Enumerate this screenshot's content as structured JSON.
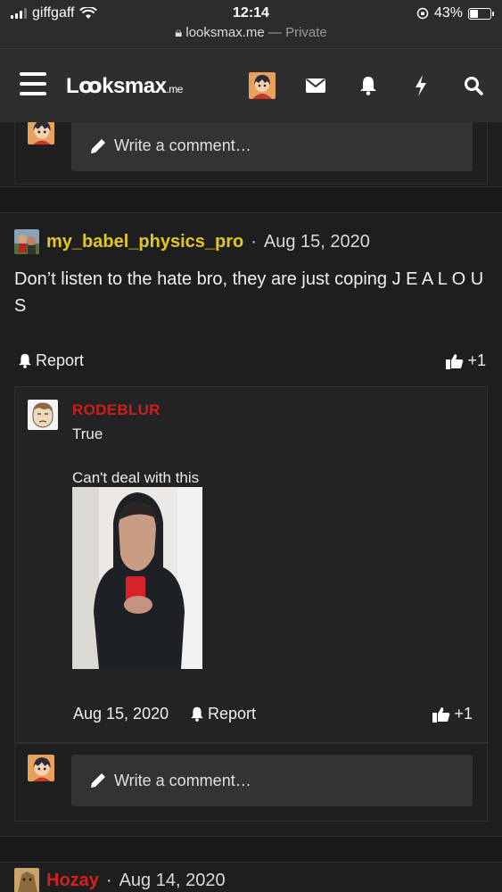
{
  "status_bar": {
    "carrier": "giffgaff",
    "time": "12:14",
    "battery": "43%",
    "battery_level": 0.43
  },
  "url_bar": {
    "domain": "looksmax.me",
    "separator": " — ",
    "mode": "Private"
  },
  "navbar": {
    "logo": "Lꝏksmax",
    "logo_suffix": ".me",
    "icons": [
      "menu-icon",
      "user-avatar",
      "envelope-icon",
      "bell-icon",
      "bolt-icon",
      "search-icon"
    ]
  },
  "top_comment_box": {
    "placeholder": "Write a comment…"
  },
  "post": {
    "username": "my_babel_physics_pro",
    "date_sep": " · ",
    "date": "Aug 15, 2020",
    "body": "Don’t listen to the hate bro, they are just coping J E A L O U S",
    "report_label": "Report",
    "reaction_count": "+1"
  },
  "reply": {
    "username": "RODEBLUR",
    "line1": "True",
    "line2": "Can't deal with this",
    "date": "Aug 15, 2020",
    "report_label": "Report",
    "reaction_count": "+1"
  },
  "bottom_comment_box": {
    "placeholder": "Write a comment…"
  },
  "next_post": {
    "username": "Hozay",
    "date_sep": " · ",
    "date": "Aug 14, 2020"
  },
  "colors": {
    "accent_yellow": "#e3c71e",
    "accent_red": "#d42020",
    "background": "#1e1e1e"
  }
}
